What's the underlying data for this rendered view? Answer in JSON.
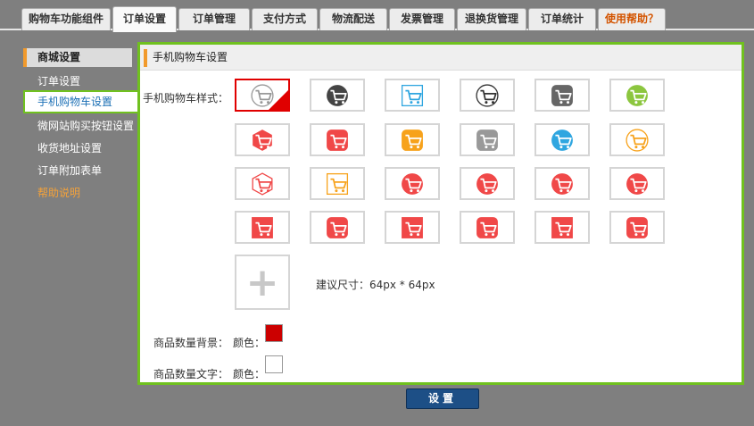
{
  "tabs": [
    {
      "label": "购物车功能组件"
    },
    {
      "label": "订单设置"
    },
    {
      "label": "订单管理"
    },
    {
      "label": "支付方式"
    },
    {
      "label": "物流配送"
    },
    {
      "label": "发票管理"
    },
    {
      "label": "退换货管理"
    },
    {
      "label": "订单统计"
    },
    {
      "label": "使用帮助？"
    }
  ],
  "sidebar": {
    "header": "商城设置",
    "items": [
      {
        "label": "订单设置"
      },
      {
        "label": "手机购物车设置"
      },
      {
        "label": "微网站购买按钮设置"
      },
      {
        "label": "收货地址设置"
      },
      {
        "label": "订单附加表单"
      },
      {
        "label": "帮助说明"
      }
    ]
  },
  "panel": {
    "title": "手机购物车设置",
    "style_label": "手机购物车样式：",
    "size_hint": "建议尺寸：64px * 64px",
    "upload_symbol": "+",
    "bg_label": "商品数量背景：",
    "bg_color_label": "颜色：",
    "bg_color": "#cc0000",
    "text_label": "商品数量文字：",
    "text_color_label": "颜色：",
    "text_color": "#ffffff"
  },
  "icons": [
    {
      "name": "cart-outline-gray-circle-icon",
      "bg": "#ffffff",
      "fg": "#999999",
      "shape": "circle-outline"
    },
    {
      "name": "cart-dark-circle-icon",
      "bg": "#444444",
      "fg": "#ffffff",
      "shape": "circle"
    },
    {
      "name": "cart-blue-outline-square-icon",
      "bg": "#ffffff",
      "fg": "#2fa6e0",
      "shape": "square-outline"
    },
    {
      "name": "cart-black-outline-circle-icon",
      "bg": "#ffffff",
      "fg": "#333333",
      "shape": "circle-outline"
    },
    {
      "name": "cart-gray-square-icon",
      "bg": "#666666",
      "fg": "#ffffff",
      "shape": "rounded"
    },
    {
      "name": "cart-green-circle-icon",
      "bg": "#8cc63f",
      "fg": "#ffffff",
      "shape": "circle"
    },
    {
      "name": "basket-red-hexagon-icon",
      "bg": "#f04848",
      "fg": "#ffffff",
      "shape": "hexagon"
    },
    {
      "name": "basket-red-rounded-icon",
      "bg": "#f04848",
      "fg": "#ffffff",
      "shape": "rounded"
    },
    {
      "name": "cart-orange-square-icon",
      "bg": "#f7a21b",
      "fg": "#ffffff",
      "shape": "rounded"
    },
    {
      "name": "cart-gray-rounded-icon",
      "bg": "#999999",
      "fg": "#ffffff",
      "shape": "rounded"
    },
    {
      "name": "cart-blue-circle-icon",
      "bg": "#2fa6e0",
      "fg": "#ffffff",
      "shape": "circle"
    },
    {
      "name": "cart-orange-outline-circle-icon",
      "bg": "#ffffff",
      "fg": "#f7a21b",
      "shape": "circle-outline"
    },
    {
      "name": "basket-red-outline-hexagon-icon",
      "bg": "#ffffff",
      "fg": "#f04848",
      "shape": "hexagon-outline"
    },
    {
      "name": "cart-orange-outline-square-icon",
      "bg": "#ffffff",
      "fg": "#f7a21b",
      "shape": "square-outline"
    },
    {
      "name": "cart-red-circle-icon-1",
      "bg": "#f04848",
      "fg": "#ffffff",
      "shape": "circle"
    },
    {
      "name": "cart-red-circle-icon-2",
      "bg": "#f04848",
      "fg": "#ffffff",
      "shape": "circle"
    },
    {
      "name": "cart-red-circle-icon-3",
      "bg": "#f04848",
      "fg": "#ffffff",
      "shape": "circle"
    },
    {
      "name": "cart-red-circle-icon-4",
      "bg": "#f04848",
      "fg": "#ffffff",
      "shape": "circle"
    },
    {
      "name": "cart-red-square-icon-1",
      "bg": "#f04848",
      "fg": "#ffffff",
      "shape": "square"
    },
    {
      "name": "cart-red-rounded-icon-1",
      "bg": "#f04848",
      "fg": "#ffffff",
      "shape": "rounded"
    },
    {
      "name": "cart-red-square-icon-2",
      "bg": "#f04848",
      "fg": "#ffffff",
      "shape": "square"
    },
    {
      "name": "cart-red-rounded-icon-2",
      "bg": "#f04848",
      "fg": "#ffffff",
      "shape": "rounded"
    },
    {
      "name": "cart-red-square-icon-3",
      "bg": "#f04848",
      "fg": "#ffffff",
      "shape": "square"
    },
    {
      "name": "cart-red-rounded-icon-3",
      "bg": "#f04848",
      "fg": "#ffffff",
      "shape": "rounded"
    }
  ],
  "submit_label": "设置"
}
